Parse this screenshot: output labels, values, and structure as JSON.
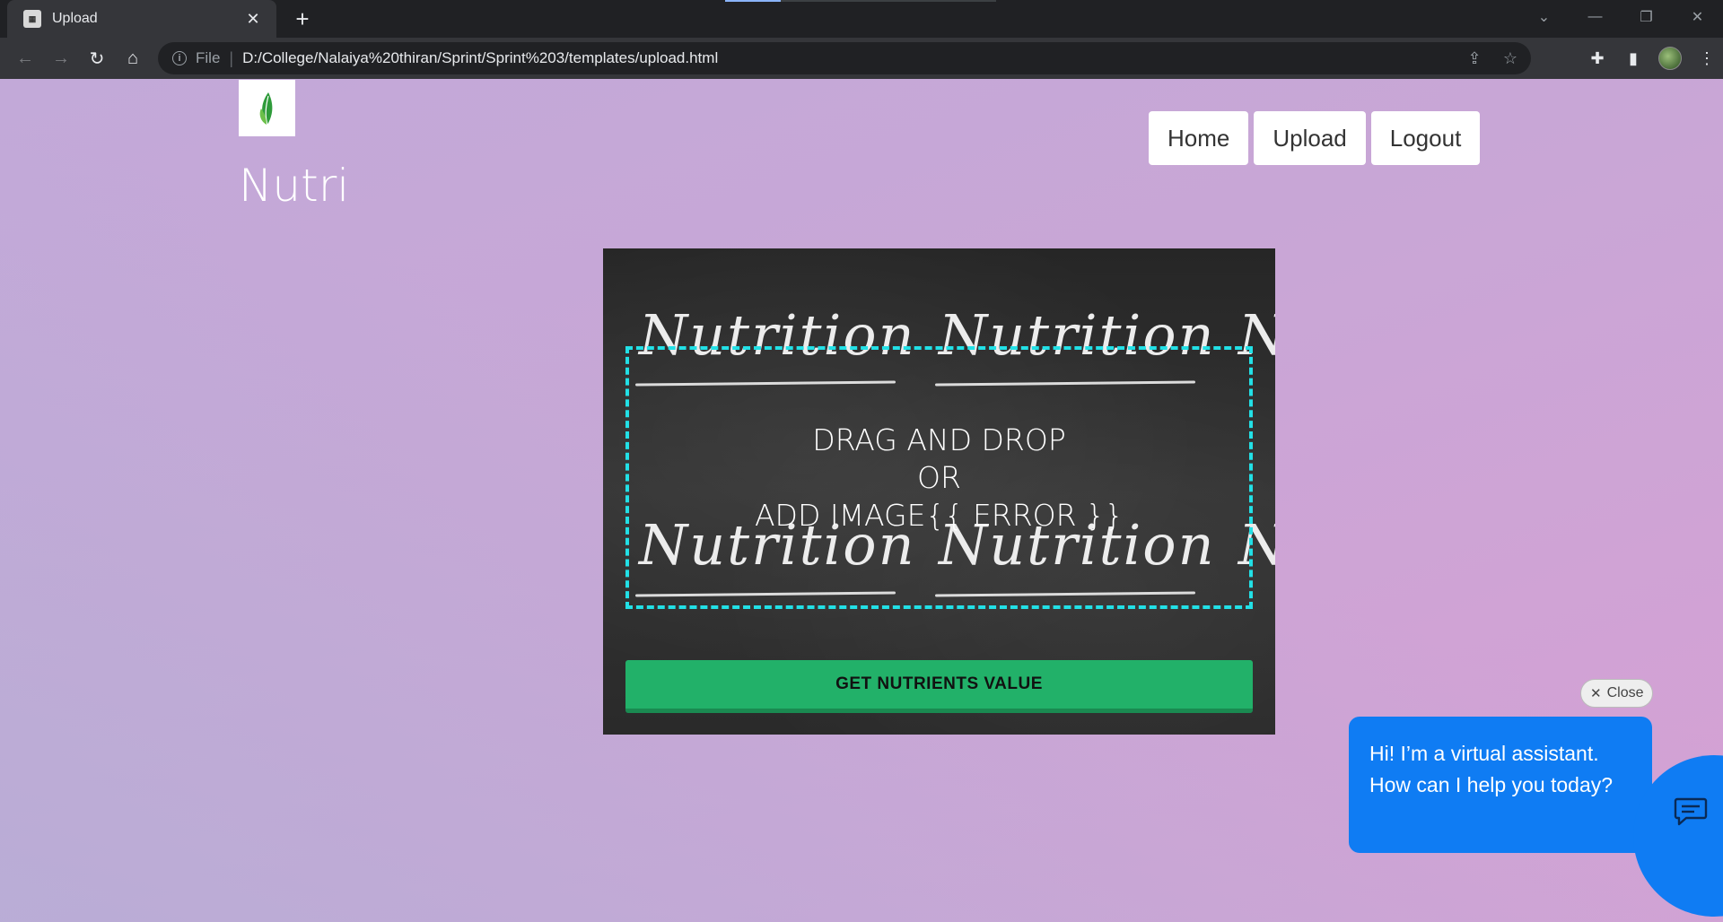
{
  "browser": {
    "tab": {
      "title": "Upload",
      "close": "✕"
    },
    "new_tab": "+",
    "address": {
      "scheme": "File",
      "separator": "|",
      "url": "D:/College/Nalaiya%20thiran/Sprint/Sprint%203/templates/upload.html"
    },
    "nav": {
      "back": "←",
      "forward": "→",
      "reload": "↻",
      "home": "⌂"
    },
    "window_controls": {
      "tab_search": "⌄",
      "minimize": "—",
      "restore": "❐",
      "close": "✕"
    },
    "omnibox_icons": {
      "share": "⇪",
      "bookmark": "☆"
    },
    "toolbar_icons": {
      "extensions": "✚",
      "side_panel": "▮",
      "menu": "⋮"
    }
  },
  "site": {
    "brand": "Nutri",
    "nav_items": [
      "Home",
      "Upload",
      "Logout"
    ]
  },
  "upload": {
    "background_words": [
      "Nutrition",
      "Nutrition",
      "N",
      "Nutrition",
      "Nutrition",
      "N"
    ],
    "drop_line_1": "DRAG AND DROP",
    "drop_line_2": "OR",
    "drop_line_3": "ADD IMAGE",
    "drop_error": "{{ ERROR }}",
    "submit_label": "GET NUTRIENTS VALUE"
  },
  "chat": {
    "close_label": "Close",
    "close_icon": "✕",
    "message": "Hi! I’m a virtual assistant. How can I help you today?"
  },
  "colors": {
    "dropzone_border": "#22e0e6",
    "submit_bg": "#22b169",
    "chat_blue": "#0f7cf3"
  }
}
